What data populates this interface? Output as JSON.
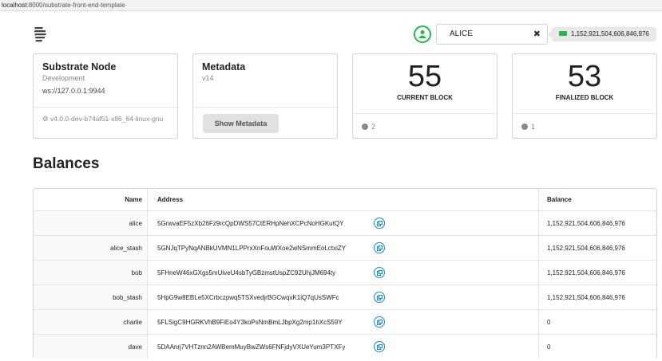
{
  "browser": {
    "url_host": "localhost",
    "url_rest": ":8000/substrate-front-end-template"
  },
  "account": {
    "selected": "ALICE",
    "clear": "✖",
    "balance": "1,152,921,504,606,846,976"
  },
  "cards": {
    "node": {
      "title": "Substrate Node",
      "meta": "Development",
      "desc": "ws://127.0.0.1:9944",
      "version": "v4.0.0-dev-b74af51-x86_64-linux-gnu"
    },
    "metadata": {
      "title": "Metadata",
      "meta": "v14",
      "button": "Show Metadata"
    },
    "current_block": {
      "number": "55",
      "label": "CURRENT BLOCK",
      "timer": "2"
    },
    "finalized_block": {
      "number": "53",
      "label": "FINALIZED BLOCK",
      "timer": "1"
    }
  },
  "balances": {
    "title": "Balances",
    "headers": {
      "name": "Name",
      "address": "Address",
      "balance": "Balance"
    },
    "rows": [
      {
        "name": "alice",
        "address": "5GrwvaEF5zXb26Fz9rcQpDWS57CtERHpNehXCPcNoHGKutQY",
        "balance": "1,152,921,504,606,846,976"
      },
      {
        "name": "alice_stash",
        "address": "5GNJqTPyNqANBkUVMN1LPPrxXnFouWXoe2wNSmmEoLctxiZY",
        "balance": "1,152,921,504,606,846,976"
      },
      {
        "name": "bob",
        "address": "5FHneW46xGXgs5mUiveU4sbTyGBzmstUspZC92UhjJM694ty",
        "balance": "1,152,921,504,606,846,976"
      },
      {
        "name": "bob_stash",
        "address": "5HpG9w8EBLe5XCrbczpwq5TSXvedjrBGCwqxK1iQ7qUsSWFc",
        "balance": "1,152,921,504,606,846,976"
      },
      {
        "name": "charlie",
        "address": "5FLSigC9HGRKVhB9FiEo4Y3koPsNmBmLJbpXg2mp1hXcS59Y",
        "balance": "0"
      },
      {
        "name": "dave",
        "address": "5DAAnrj7VHTznn2AWBemMuyBwZWs6FNFjdyVXUeYum3PTXFy",
        "balance": "0"
      }
    ]
  }
}
